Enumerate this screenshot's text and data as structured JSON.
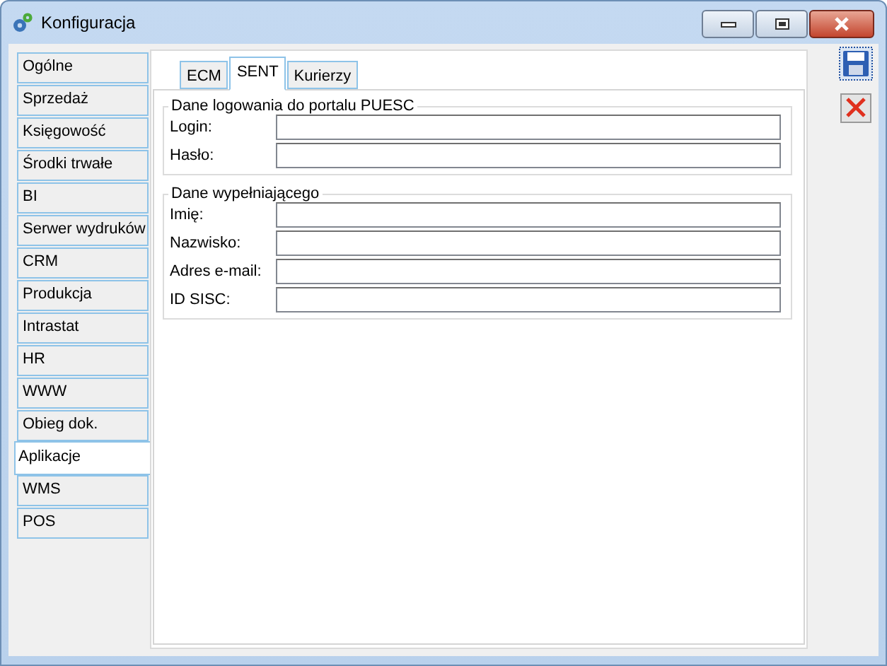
{
  "window": {
    "title": "Konfiguracja"
  },
  "sidebar": {
    "items": [
      {
        "label": "Ogólne",
        "selected": false
      },
      {
        "label": "Sprzedaż",
        "selected": false
      },
      {
        "label": "Księgowość",
        "selected": false
      },
      {
        "label": "Środki trwałe",
        "selected": false
      },
      {
        "label": "BI",
        "selected": false
      },
      {
        "label": "Serwer wydruków",
        "selected": false
      },
      {
        "label": "CRM",
        "selected": false
      },
      {
        "label": "Produkcja",
        "selected": false
      },
      {
        "label": "Intrastat",
        "selected": false
      },
      {
        "label": "HR",
        "selected": false
      },
      {
        "label": "WWW",
        "selected": false
      },
      {
        "label": "Obieg dok.",
        "selected": false
      },
      {
        "label": "Aplikacje",
        "selected": true
      },
      {
        "label": "WMS",
        "selected": false
      },
      {
        "label": "POS",
        "selected": false
      }
    ]
  },
  "tabs": [
    {
      "label": "ECM",
      "selected": false
    },
    {
      "label": "SENT",
      "selected": true
    },
    {
      "label": "Kurierzy",
      "selected": false
    }
  ],
  "groups": [
    {
      "title": "Dane logowania do portalu PUESC",
      "fields": [
        {
          "label": "Login:"
        },
        {
          "label": "Hasło:"
        }
      ]
    },
    {
      "title": "Dane wypełniającego",
      "fields": [
        {
          "label": "Imię:"
        },
        {
          "label": "Nazwisko:"
        },
        {
          "label": "Adres e-mail:"
        },
        {
          "label": "ID SISC:"
        }
      ]
    }
  ]
}
